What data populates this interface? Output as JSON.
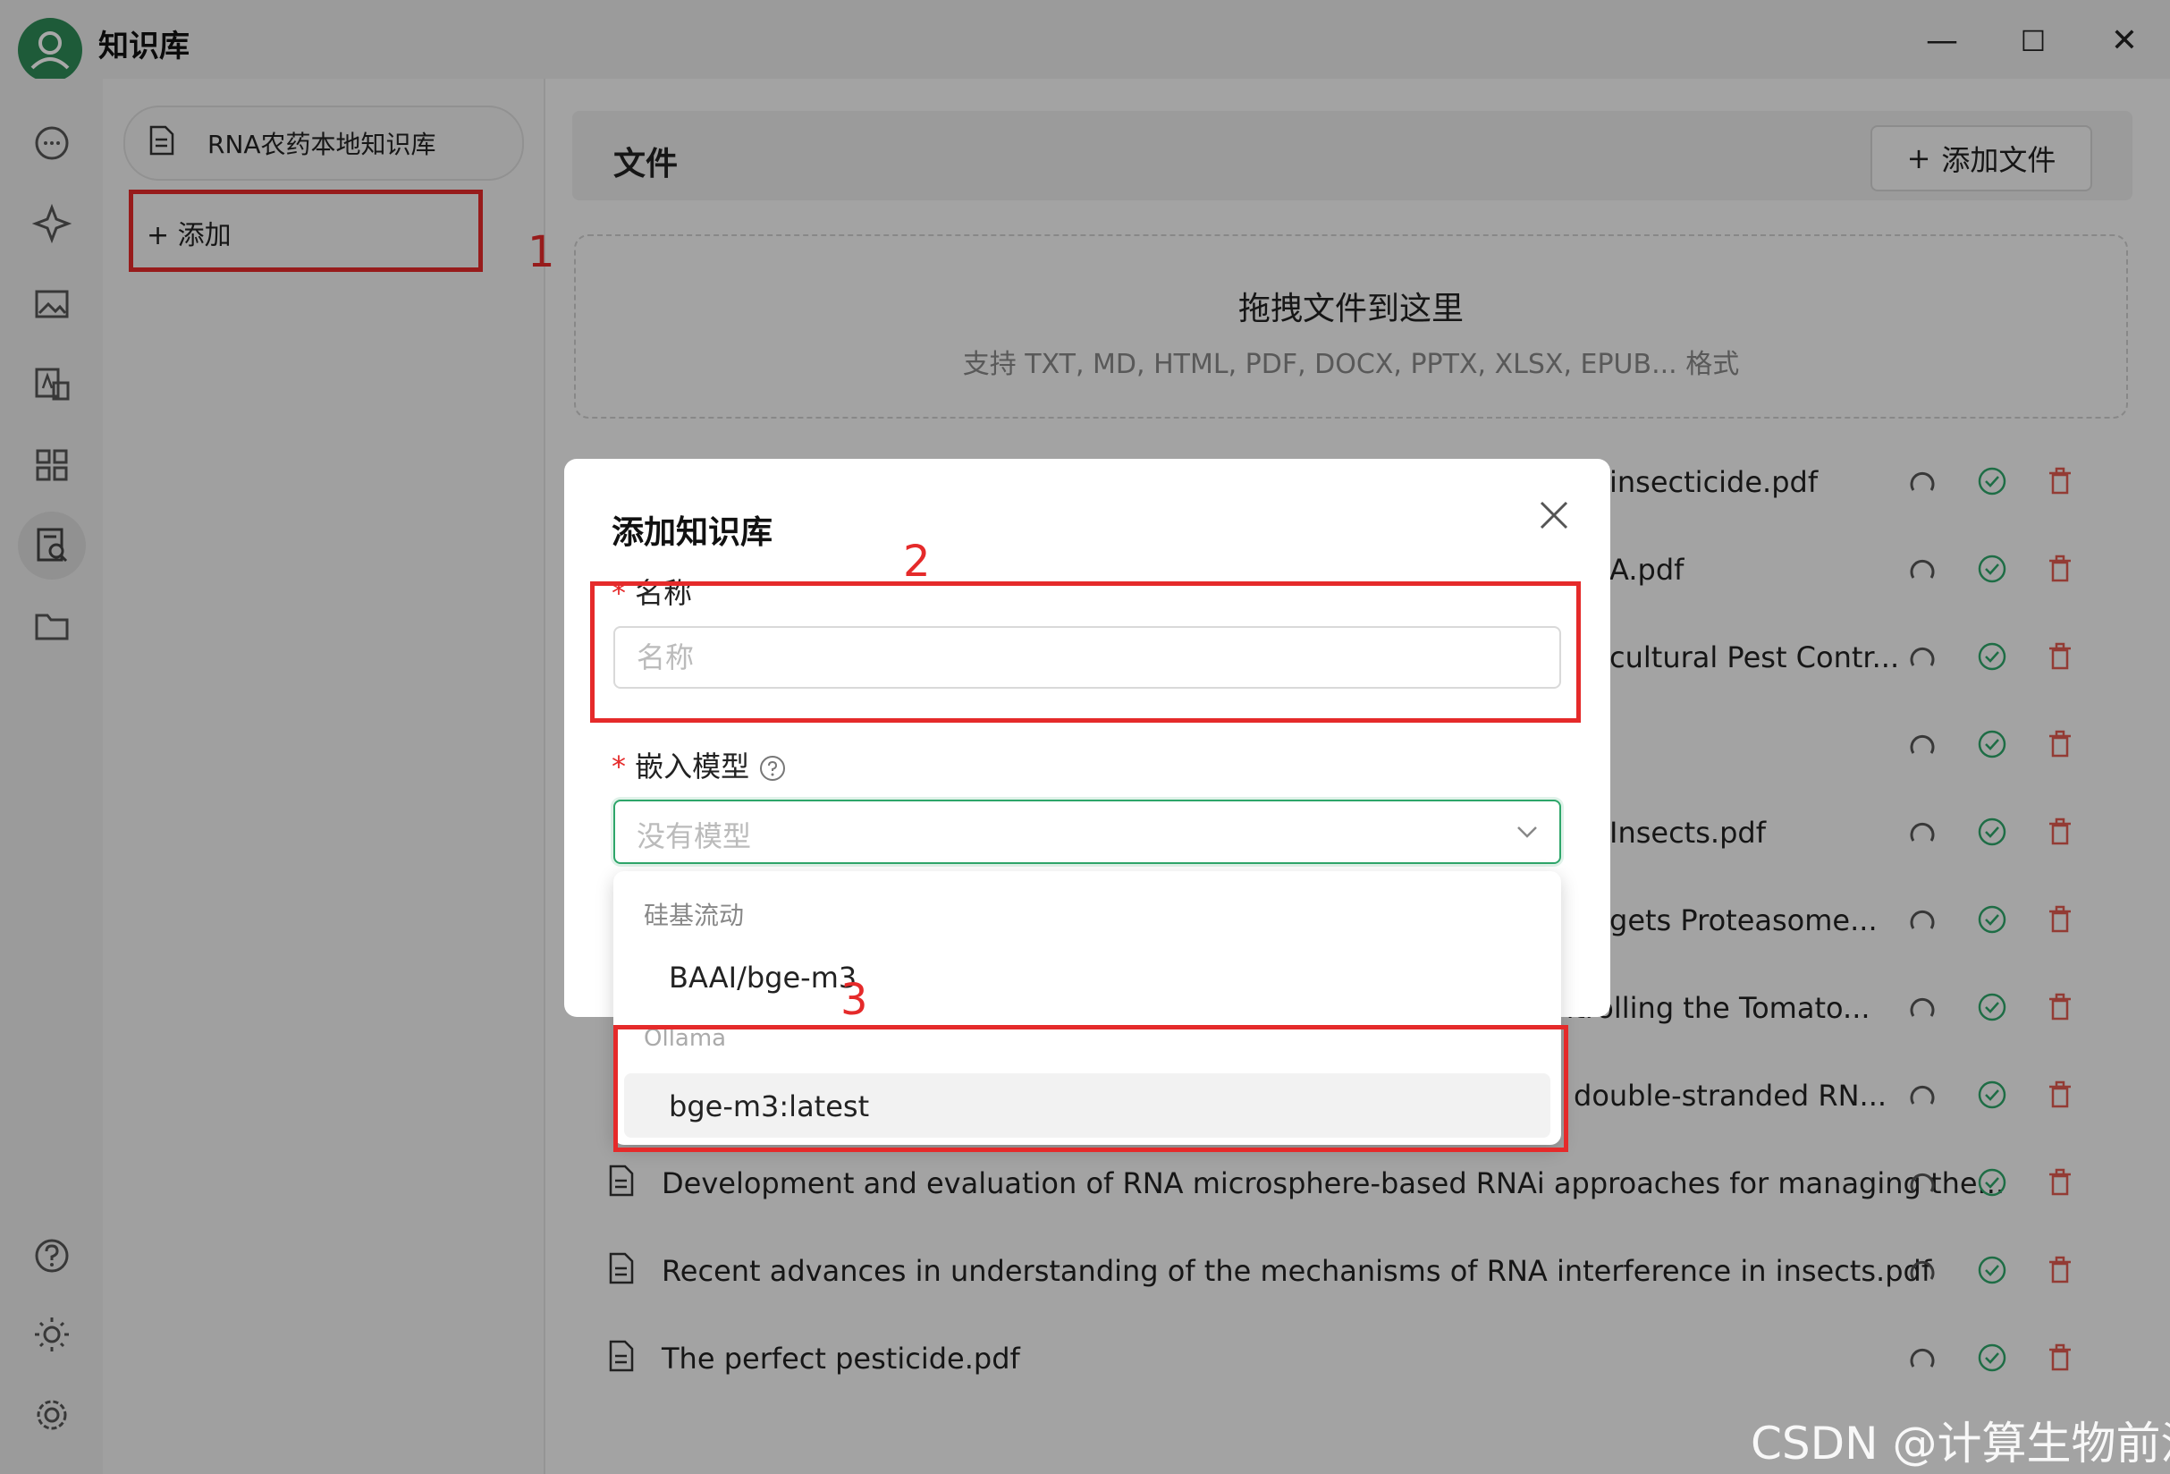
{
  "window": {
    "title": "知识库",
    "minimize": "—",
    "maximize": "☐",
    "close": "✕"
  },
  "rail": [
    {
      "name": "chat-icon"
    },
    {
      "name": "sparkle-icon"
    },
    {
      "name": "image-icon"
    },
    {
      "name": "translate-icon"
    },
    {
      "name": "apps-icon"
    },
    {
      "name": "knowledge-icon"
    },
    {
      "name": "folder-icon"
    },
    {
      "name": "help-icon"
    },
    {
      "name": "theme-icon"
    },
    {
      "name": "settings-icon"
    }
  ],
  "kb": {
    "item_label": "RNA农药本地知识库",
    "add_label": "+ 添加"
  },
  "annotations": {
    "one": "1",
    "two": "2",
    "three": "3"
  },
  "files": {
    "title": "文件",
    "add_file_label": "添加文件",
    "drop_title": "拖拽文件到这里",
    "drop_sub": "支持 TXT, MD, HTML, PDF, DOCX, PPTX, XLSX, EPUB... 格式",
    "rows": [
      {
        "name": "insecticide.pdf",
        "show_icon": false
      },
      {
        "name": "A.pdf",
        "show_icon": false
      },
      {
        "name": "cultural Pest Contr...",
        "show_icon": false
      },
      {
        "name": "",
        "show_icon": false
      },
      {
        "name": "Insects.pdf",
        "show_icon": false
      },
      {
        "name": "gets Proteasome...",
        "show_icon": false
      },
      {
        "name": "ntrolling the Tomato...",
        "show_icon": false
      },
      {
        "name": "double-stranded RN...",
        "show_icon": false
      },
      {
        "name": "Development and evaluation of RNA microsphere-based RNAi approaches for managing the...",
        "show_icon": true
      },
      {
        "name": "Recent advances in understanding of the mechanisms of RNA interference in insects.pdf",
        "show_icon": true
      },
      {
        "name": "The perfect pesticide.pdf",
        "show_icon": true
      }
    ],
    "status_colors": {
      "refresh": "#555555",
      "ok": "#2ea66a",
      "delete": "#e05a4f"
    }
  },
  "modal": {
    "title": "添加知识库",
    "name_label": "名称",
    "name_placeholder": "名称",
    "required_mark": "*",
    "embed_label": "嵌入模型",
    "embed_placeholder": "没有模型",
    "groups": [
      {
        "label": "硅基流动",
        "options": [
          "BAAI/bge-m3"
        ]
      },
      {
        "label": "Ollama",
        "options": [
          "bge-m3:latest"
        ]
      }
    ]
  },
  "watermark": "CSDN @计算生物前沿",
  "accent": "#2ea66a",
  "highlight": "#e52a2a"
}
